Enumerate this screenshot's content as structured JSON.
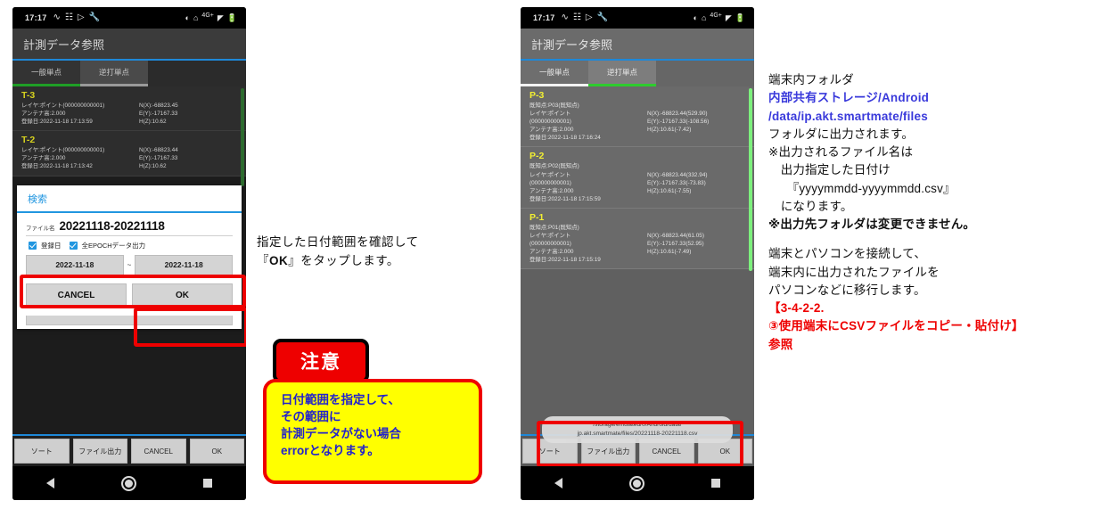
{
  "status_bar": {
    "time": "17:17",
    "left_icons": [
      "wave-icon",
      "sim-card-icon",
      "send-icon",
      "wrench-icon"
    ],
    "right_icons": [
      "brightness-icon",
      "vpn-icon",
      "signal-icon",
      "battery-icon"
    ],
    "network_label": "4G+"
  },
  "phone_left": {
    "app_title": "計測データ参照",
    "tabs": [
      {
        "label": "一般単点",
        "selected": true
      },
      {
        "label": "逆打単点",
        "selected": false
      }
    ],
    "records": [
      {
        "title": "T-3",
        "layer": "レイヤ:ポイント(000000000001)",
        "antenna": "アンテナ高:2.000",
        "registered": "登録日:2022-11-18 17:13:59",
        "n": "N(X):-68823.45",
        "e": "E(Y):-17167.33",
        "h": "H(Z):10.62"
      },
      {
        "title": "T-2",
        "layer": "レイヤ:ポイント(000000000001)",
        "antenna": "アンテナ高:2.000",
        "registered": "登録日:2022-11-18 17:13:42",
        "n": "N(X):-68823.44",
        "e": "E(Y):-17167.33",
        "h": "H(Z):10.62"
      }
    ],
    "bottom_buttons": [
      "ソート",
      "ファイル出力",
      "CANCEL",
      "OK"
    ],
    "dialog": {
      "title": "検索",
      "filename_label": "ファイル名",
      "filename_value": "20221118-20221118",
      "checkbox_1": "登録日",
      "checkbox_2": "全EPOCHデータ出力",
      "date_from": "2022-11-18",
      "date_separator": "~",
      "date_to": "2022-11-18",
      "cancel_label": "CANCEL",
      "ok_label": "OK"
    }
  },
  "phone_right": {
    "app_title": "計測データ参照",
    "tabs": [
      {
        "label": "一般単点",
        "selected": false
      },
      {
        "label": "逆打単点",
        "selected": true
      }
    ],
    "records": [
      {
        "title": "P-3",
        "known_point": "既知点:P03(既知点)",
        "layer": "レイヤ:ポイント",
        "layer_id": "(000000000001)",
        "antenna": "アンテナ高:2.000",
        "registered": "登録日:2022-11-18 17:16:24",
        "n": "N(X):-68823.44(529.90)",
        "e": "E(Y):-17167.33(-108.56)",
        "h": "H(Z):10.61(-7.42)"
      },
      {
        "title": "P-2",
        "known_point": "既知点:P02(既知点)",
        "layer": "レイヤ:ポイント",
        "layer_id": "(000000000001)",
        "antenna": "アンテナ高:2.000",
        "registered": "登録日:2022-11-18 17:15:59",
        "n": "N(X):-68823.44(332.94)",
        "e": "E(Y):-17167.33(-73.83)",
        "h": "H(Z):10.61(-7.55)"
      },
      {
        "title": "P-1",
        "known_point": "既知点:P01(既知点)",
        "layer": "レイヤ:ポイント",
        "layer_id": "(000000000001)",
        "antenna": "アンテナ高:2.000",
        "registered": "登録日:2022-11-18 17:15:19",
        "n": "N(X):-68823.44(61.05)",
        "e": "E(Y):-17167.33(52.95)",
        "h": "H(Z):10.61(-7.49)"
      }
    ],
    "bottom_buttons": [
      "ソート",
      "ファイル出力",
      "CANCEL",
      "OK"
    ],
    "toast": {
      "line1": "/storage/emulated/0/Android/data/",
      "line2": "jp.akt.smartmate/files/20221118-20221118.csv"
    }
  },
  "annotation_middle": {
    "line1": "指定した日付範囲を確認して",
    "line2_quote_open": "『",
    "line2_ok": "OK",
    "line2_rest": "』をタップします。"
  },
  "caution": {
    "label": "注意"
  },
  "warning_box": {
    "line1": "日付範囲を指定して、",
    "line2": "その範囲に",
    "line3": "計測データがない場合",
    "line4": "errorとなります。"
  },
  "annotation_right": {
    "line1": "端末内フォルダ",
    "line2": "内部共有ストレージ/Android",
    "line3": "/data/ip.akt.smartmate/files",
    "line4": "フォルダに出力されます。",
    "line5": "※出力されるファイル名は",
    "line6": "　出力指定した日付け",
    "line7": "　　『yyyymmdd-yyyymmdd.csv』",
    "line8": "　になります。",
    "line9": "※出力先フォルダは変更できません。",
    "line10": "端末とパソコンを接続して、",
    "line11": "端末内に出力されたファイルを",
    "line12": "パソコンなどに移行します。",
    "line13": "【3-4-2-2.",
    "line14": "③使用端末にCSVファイルをコピー・貼付け】",
    "line15": "参照"
  },
  "colors": {
    "accent_blue": "#1e88d8",
    "highlight_red": "#ee0000",
    "warning_yellow": "#ffff00",
    "warning_text_blue": "#2222cc",
    "tab_green": "#1f9e26",
    "record_title_yellow": "#d6d11f"
  }
}
